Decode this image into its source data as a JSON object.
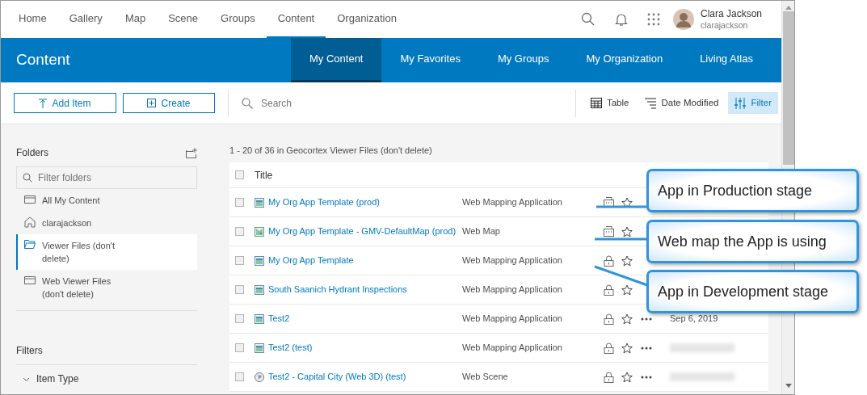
{
  "top_nav": {
    "tabs": [
      {
        "label": "Home",
        "selected": false
      },
      {
        "label": "Gallery",
        "selected": false
      },
      {
        "label": "Map",
        "selected": false
      },
      {
        "label": "Scene",
        "selected": false
      },
      {
        "label": "Groups",
        "selected": false
      },
      {
        "label": "Content",
        "selected": true
      },
      {
        "label": "Organization",
        "selected": false
      }
    ],
    "user": {
      "name": "Clara Jackson",
      "username": "clarajackson"
    }
  },
  "header": {
    "title": "Content",
    "tabs": [
      {
        "label": "My Content",
        "selected": true
      },
      {
        "label": "My Favorites",
        "selected": false
      },
      {
        "label": "My Groups",
        "selected": false
      },
      {
        "label": "My Organization",
        "selected": false
      },
      {
        "label": "Living Atlas",
        "selected": false
      }
    ]
  },
  "toolbar": {
    "add_item": "Add Item",
    "create": "Create",
    "search": {
      "placeholder": "Search"
    },
    "views": [
      {
        "kind": "table",
        "label": "Table",
        "selected": false
      },
      {
        "kind": "sort",
        "label": "Date Modified",
        "selected": false
      },
      {
        "kind": "filter",
        "label": "Filter",
        "selected": true
      }
    ]
  },
  "sidebar": {
    "folders_title": "Folders",
    "filter": {
      "placeholder": "Filter folders"
    },
    "folders": [
      {
        "kind": "all",
        "label": "All My Content",
        "selected": false
      },
      {
        "kind": "home",
        "label": "clarajackson",
        "selected": false
      },
      {
        "kind": "folder",
        "label": "Viewer Files (don't delete)",
        "selected": true
      },
      {
        "kind": "folder",
        "label": "Web Viewer Files (don't delete)",
        "selected": false
      }
    ],
    "filters_title": "Filters",
    "filter_groups": [
      {
        "label": "Item Type",
        "expanded": true
      }
    ]
  },
  "results": {
    "summary": "1 - 20 of 36 in Geocortex Viewer Files (don't delete)",
    "all_checked": false,
    "columns": [
      "Title"
    ],
    "rows": [
      {
        "kind": "app",
        "title": "My Org App Template (prod)",
        "type": "Web Mapping Application",
        "org_shared": true,
        "checked": false,
        "menu": false,
        "date_blurred": false
      },
      {
        "kind": "map",
        "title": "My Org App Template - GMV-DefaultMap (prod)",
        "type": "Web Map",
        "org_shared": true,
        "checked": false,
        "menu": false,
        "date_blurred": false
      },
      {
        "kind": "app",
        "title": "My Org App Template",
        "type": "Web Mapping Application",
        "org_shared": false,
        "checked": false,
        "menu": false,
        "date_blurred": false
      },
      {
        "kind": "app",
        "title": "South Saanich Hydrant Inspections",
        "type": "Web Mapping Application",
        "org_shared": false,
        "checked": false,
        "menu": false,
        "date_blurred": false
      },
      {
        "kind": "app",
        "title": "Test2",
        "type": "Web Mapping Application",
        "org_shared": false,
        "checked": false,
        "menu": true,
        "date": "Sep 6, 2019",
        "date_blurred": false
      },
      {
        "kind": "app",
        "title": "Test2 (test)",
        "type": "Web Mapping Application",
        "org_shared": false,
        "checked": false,
        "menu": true,
        "date_blurred": true
      },
      {
        "kind": "scene",
        "title": "Test2 - Capital City (Web 3D) (test)",
        "type": "Web Scene",
        "org_shared": false,
        "checked": false,
        "menu": true,
        "date_blurred": true
      }
    ]
  },
  "callouts": [
    {
      "text": "App in Production stage"
    },
    {
      "text": "Web map the App is using"
    },
    {
      "text": "App in Development stage"
    }
  ]
}
